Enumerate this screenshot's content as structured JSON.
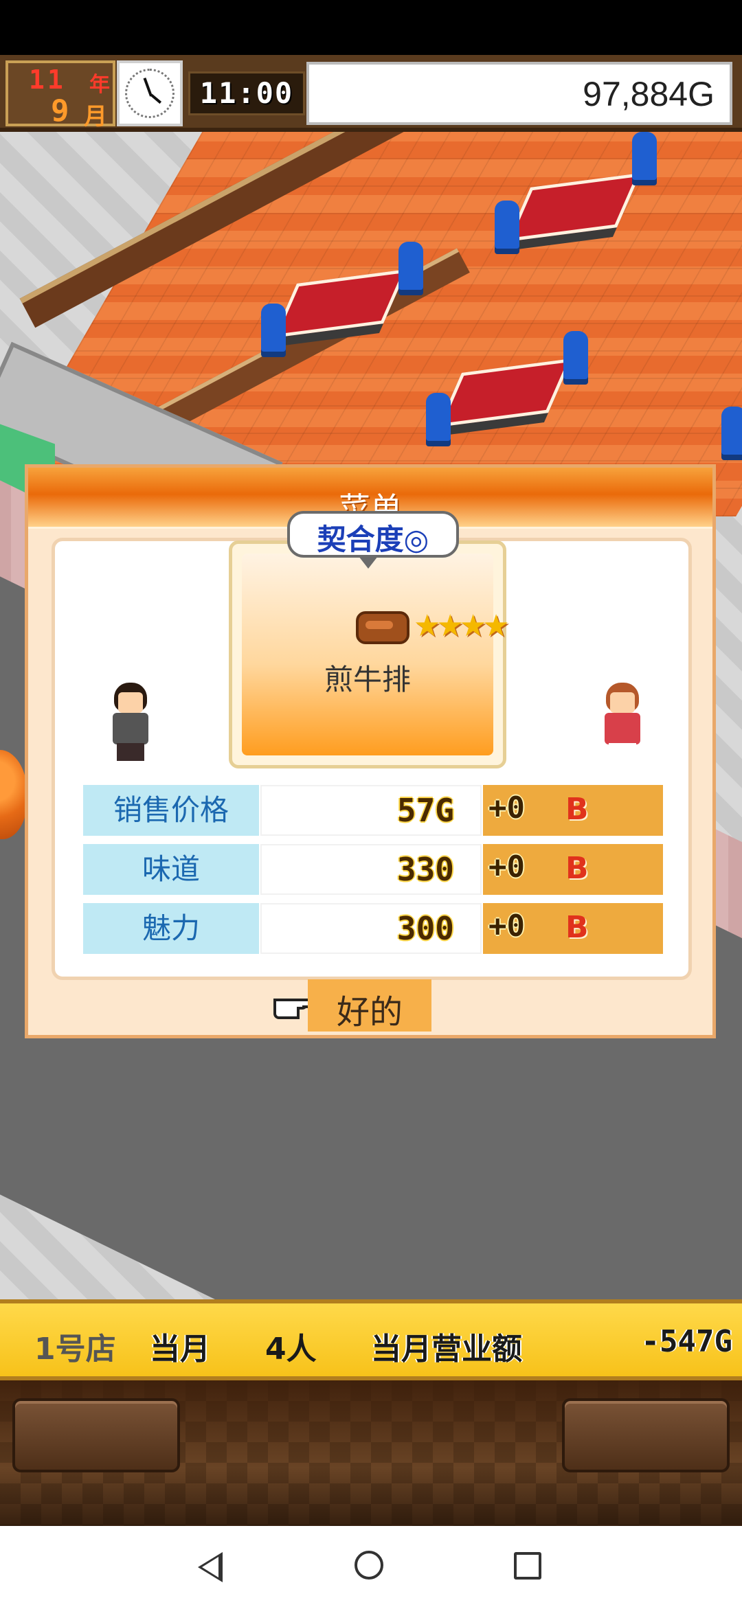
{
  "hud": {
    "year": "11",
    "year_unit": "年",
    "month": "9",
    "month_unit": "月",
    "time": "11:00",
    "money": "97,884G"
  },
  "dialog": {
    "title": "菜单",
    "compatibility_label": "契合度◎",
    "dish": {
      "name": "煎牛排",
      "rating_stars": 4,
      "stars_text": "★★★★",
      "icon": "steak-icon"
    },
    "stats": [
      {
        "label": "销售价格",
        "value": "57G",
        "bonus": "+0",
        "grade": "B"
      },
      {
        "label": "味道",
        "value": "330",
        "bonus": "+0",
        "grade": "B"
      },
      {
        "label": "魅力",
        "value": "300",
        "bonus": "+0",
        "grade": "B"
      }
    ],
    "ok_label": "好的"
  },
  "bottom_bar": {
    "store": "1号店",
    "period": "当月",
    "customers": "4人",
    "revenue_label": "当月营业额",
    "revenue_value": "-547G"
  },
  "colors": {
    "title_orange": "#ea6a0a",
    "label_bg": "#bfe9f4",
    "label_text": "#1b68b0",
    "bonus_bg": "#eeaa3e",
    "grade_red": "#e0321c",
    "bottom_bar_yellow": "#f7c21a"
  },
  "nav": {
    "icons": [
      "back-icon",
      "home-icon",
      "recent-apps-icon"
    ]
  }
}
